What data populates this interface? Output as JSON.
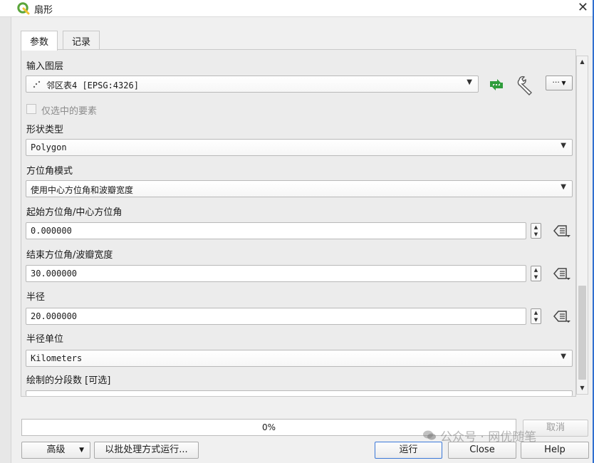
{
  "window": {
    "title": "扇形",
    "close_glyph": "✕"
  },
  "tabs": [
    {
      "label": "参数",
      "active": true
    },
    {
      "label": "记录",
      "active": false
    }
  ],
  "params": {
    "input_layer": {
      "label": "输入图层",
      "value": "邻区表4 [EPSG:4326]",
      "more_label": "···"
    },
    "selected_only": {
      "label": "仅选中的要素",
      "checked": false,
      "enabled": false
    },
    "shape_type": {
      "label": "形状类型",
      "value": "Polygon"
    },
    "azimuth_mode": {
      "label": "方位角模式",
      "value": "使用中心方位角和波瓣宽度"
    },
    "start_azimuth": {
      "label": "起始方位角/中心方位角",
      "value": "0.000000"
    },
    "end_azimuth": {
      "label": "结束方位角/波瓣宽度",
      "value": "30.000000"
    },
    "radius": {
      "label": "半径",
      "value": "20.000000"
    },
    "radius_unit": {
      "label": "半径单位",
      "value": "Kilometers"
    },
    "segments": {
      "label": "绘制的分段数 [可选]"
    }
  },
  "progress": {
    "value_text": "0%",
    "percent": 0
  },
  "buttons": {
    "advanced": "高级",
    "batch": "以批处理方式运行...",
    "run": "运行",
    "cancel": "取消",
    "close": "Close",
    "help": "Help"
  },
  "watermark": {
    "text": "公众号 · 网优随笔"
  },
  "colors": {
    "accent": "#3b78d8",
    "qgis_green": "#5aa53a",
    "icon_green": "#2e9c3b"
  }
}
